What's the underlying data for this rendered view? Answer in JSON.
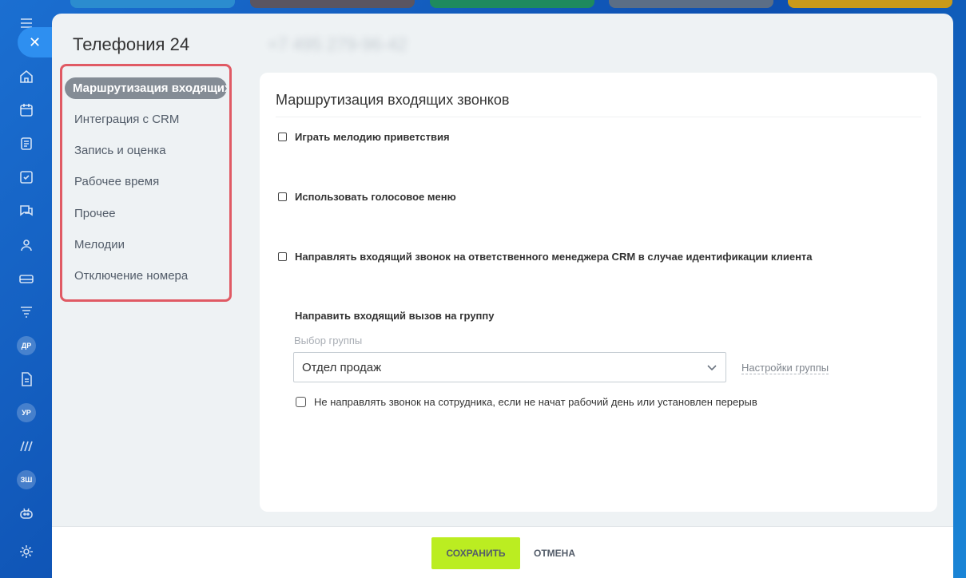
{
  "rail": {
    "close_glyph": "✕",
    "badges": [
      "ДР",
      "УР",
      "ЗШ"
    ]
  },
  "slider": {
    "title": "Телефония 24",
    "phone": "+7 495 279-96-42"
  },
  "menu": {
    "items": [
      {
        "label": "Маршрутизация входящих звонков",
        "active": true
      },
      {
        "label": "Интеграция с CRM"
      },
      {
        "label": "Запись и оценка"
      },
      {
        "label": "Рабочее время"
      },
      {
        "label": "Прочее"
      },
      {
        "label": "Мелодии"
      },
      {
        "label": "Отключение номера"
      }
    ]
  },
  "card": {
    "title": "Маршрутизация входящих звонков",
    "options": [
      {
        "label": "Играть мелодию приветствия",
        "checked": false
      },
      {
        "label": "Использовать голосовое меню",
        "checked": false
      },
      {
        "label": "Направлять входящий звонок на ответственного менеджера CRM в случае идентификации клиента",
        "checked": false
      }
    ],
    "group_section_label": "Направить входящий вызов на группу",
    "group_field_label": "Выбор группы",
    "group_selected": "Отдел продаж",
    "group_settings_link": "Настройки группы",
    "skip_option": {
      "label": "Не направлять звонок на сотрудника, если не начат рабочий день или установлен перерыв",
      "checked": false
    }
  },
  "footer": {
    "save_label": "СОХРАНИТЬ",
    "cancel_label": "ОТМЕНА"
  },
  "colors": {
    "accent_save": "#bbed21",
    "menu_highlight_border": "#e05a64",
    "menu_active_bg": "#848c95"
  }
}
